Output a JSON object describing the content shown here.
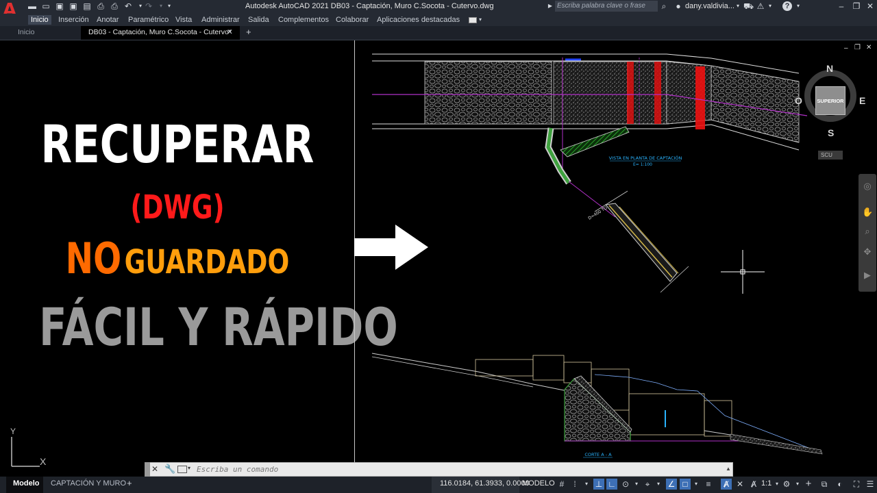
{
  "app": {
    "logo_letter": "A",
    "title": "Autodesk AutoCAD 2021   DB03 - Captación, Muro C.Socota - Cutervo.dwg",
    "search_placeholder": "Escriba palabra clave o frase",
    "user": "dany.valdivia...",
    "help_glyph": "?"
  },
  "ribbon_tabs": [
    "Inicio",
    "Inserción",
    "Anotar",
    "Paramétrico",
    "Vista",
    "Administrar",
    "Salida",
    "Complementos",
    "Colaborar",
    "Aplicaciones destacadas"
  ],
  "file_tabs": {
    "home": "Inicio",
    "doc": "DB03 - Captación, Muro C.Socota - Cutervo*",
    "close": "✕",
    "add": "+"
  },
  "overlay": {
    "line1": "RECUPERAR",
    "line2": "(DWG)",
    "line3a": "NO",
    "line3b": "GUARDADO",
    "line4": "FÁCIL Y RÁPIDO",
    "colors": {
      "white": "#ffffff",
      "red": "#ff1a1a",
      "orange": "#ff6a00",
      "amber": "#ff9e0c",
      "gray": "#9a9a9a"
    }
  },
  "drawing": {
    "label_plan": "VISTA EN PLANTA DE CAPTACIÓN",
    "label_scale": "E= 1:100",
    "label_section": "CORTE A - A",
    "label_diag": "D=400 TO",
    "ucs_x": "X",
    "ucs_y": "Y"
  },
  "viewcube": {
    "n": "N",
    "s": "S",
    "e": "E",
    "w": "O",
    "face": "SUPERIOR",
    "wcs": "SCU"
  },
  "command": {
    "placeholder": "Escriba un comando"
  },
  "status": {
    "tab_model": "Modelo",
    "tab_layout": "CAPTACIÓN Y MURO",
    "add": "+",
    "coords": "116.0184, 61.3933, 0.0000",
    "mode": "MODELO",
    "scale": "1:1"
  }
}
